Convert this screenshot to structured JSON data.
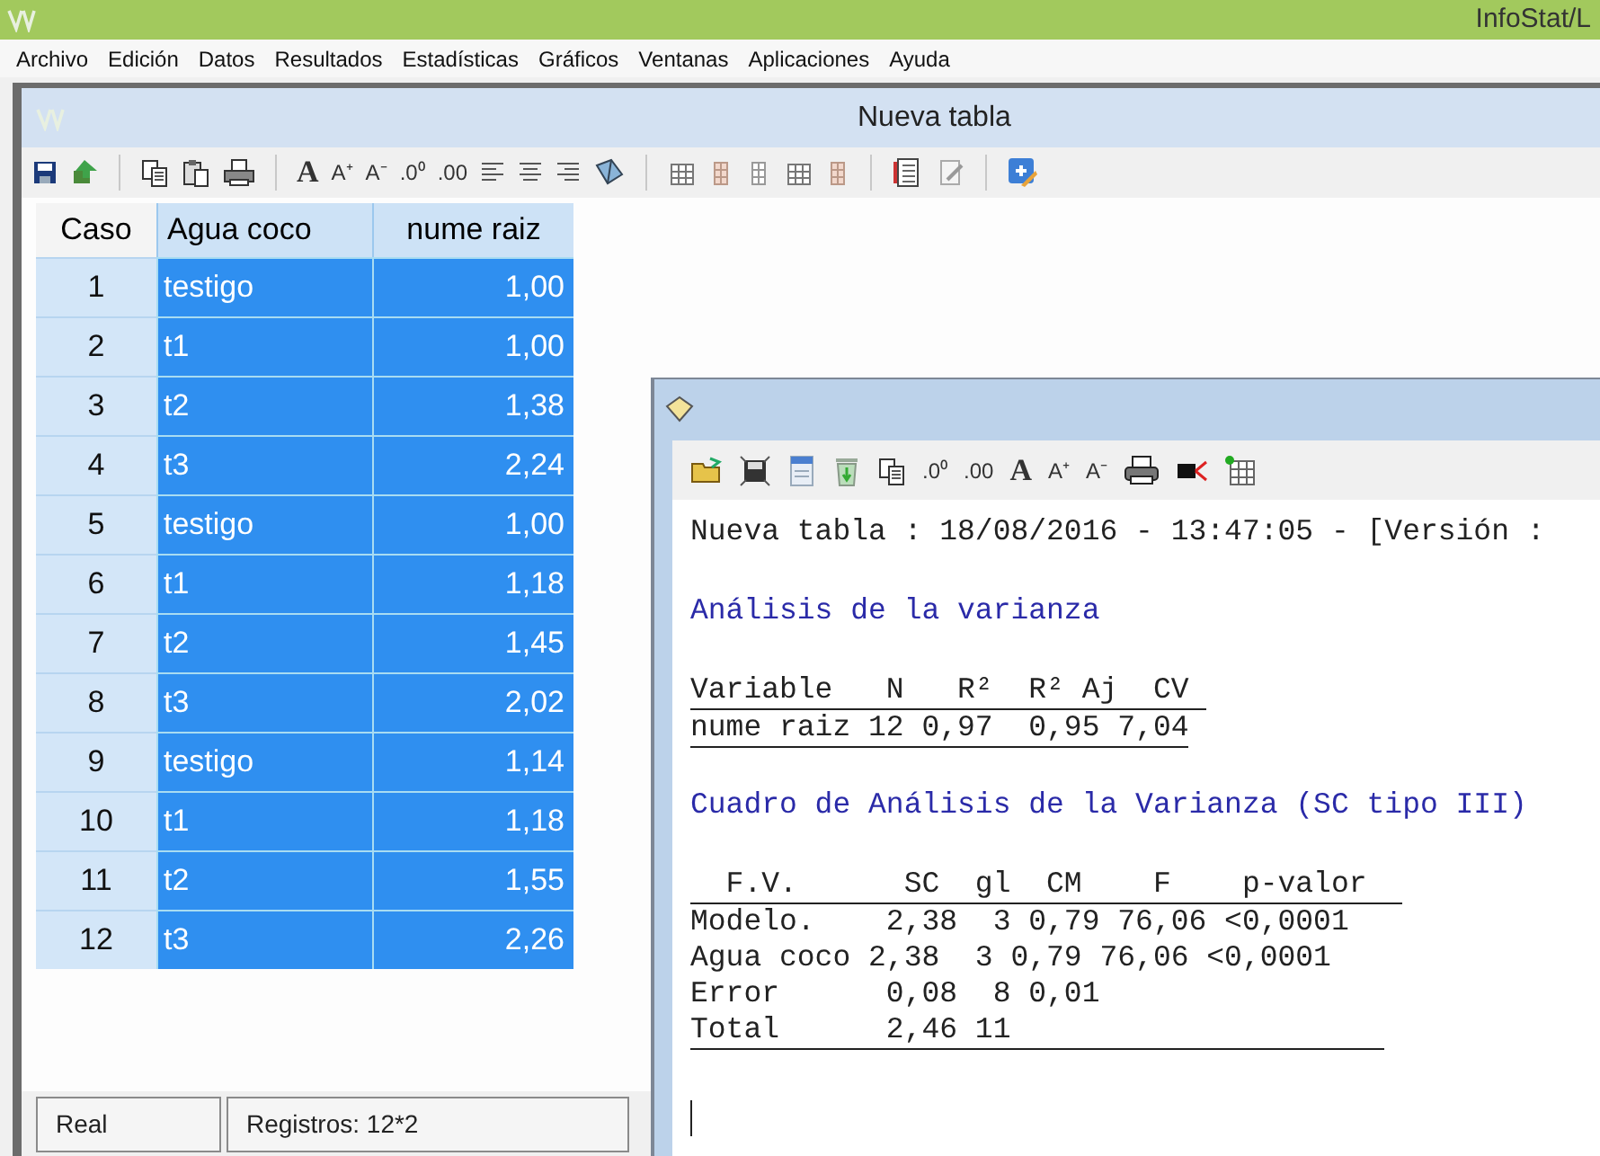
{
  "app": {
    "title": "InfoStat/L"
  },
  "menu": [
    "Archivo",
    "Edición",
    "Datos",
    "Resultados",
    "Estadísticas",
    "Gráficos",
    "Ventanas",
    "Aplicaciones",
    "Ayuda"
  ],
  "table_window": {
    "title": "Nueva tabla",
    "format_buttons": [
      {
        "kind": "font",
        "label": "A"
      },
      {
        "kind": "small",
        "label": "A⁺"
      },
      {
        "kind": "small",
        "label": "A⁻"
      },
      {
        "kind": "small",
        "label": ".0⁰"
      },
      {
        "kind": "small",
        "label": ".00"
      }
    ]
  },
  "table": {
    "columns": [
      "Caso",
      "Agua coco",
      "nume raiz"
    ],
    "rows": [
      {
        "caso": "1",
        "agua": "testigo",
        "nume": "1,00",
        "selected": true
      },
      {
        "caso": "2",
        "agua": "t1",
        "nume": "1,00",
        "selected": true
      },
      {
        "caso": "3",
        "agua": "t2",
        "nume": "1,38",
        "selected": true
      },
      {
        "caso": "4",
        "agua": "t3",
        "nume": "2,24",
        "selected": true
      },
      {
        "caso": "5",
        "agua": "testigo",
        "nume": "1,00",
        "selected": true
      },
      {
        "caso": "6",
        "agua": "t1",
        "nume": "1,18",
        "selected": true
      },
      {
        "caso": "7",
        "agua": "t2",
        "nume": "1,45",
        "selected": true
      },
      {
        "caso": "8",
        "agua": "t3",
        "nume": "2,02",
        "selected": true
      },
      {
        "caso": "9",
        "agua": "testigo",
        "nume": "1,14",
        "selected": true
      },
      {
        "caso": "10",
        "agua": "t1",
        "nume": "1,18",
        "selected": true
      },
      {
        "caso": "11",
        "agua": "t2",
        "nume": "1,55",
        "selected": true
      },
      {
        "caso": "12",
        "agua": "t3",
        "nume": "2,26",
        "selected": true
      }
    ]
  },
  "status_bar": [
    "Real",
    "Registros: 12*2"
  ],
  "output_window": {
    "format_buttons": [
      {
        "kind": "small",
        "label": ".0⁰"
      },
      {
        "kind": "small",
        "label": ".00"
      },
      {
        "kind": "font",
        "label": "A"
      },
      {
        "kind": "small",
        "label": "A⁺"
      },
      {
        "kind": "small",
        "label": "A⁻"
      }
    ],
    "lines": [
      {
        "kind": "info",
        "text": "Nueva tabla : 18/08/2016 - 13:47:05 - [Versión :"
      },
      {
        "kind": "title",
        "text": "Análisis de la varianza"
      },
      {
        "kind": "header",
        "text": "Variable   N   R²  R² Aj  CV "
      },
      {
        "kind": "end_row",
        "text": "nume raiz 12 0,97  0,95 7,04"
      },
      {
        "kind": "title",
        "text": "Cuadro de Análisis de la Varianza (SC tipo III)"
      },
      {
        "kind": "header",
        "text": "  F.V.      SC  gl  CM    F    p-valor  "
      },
      {
        "kind": "row",
        "text": "Modelo.    2,38  3 0,79 76,06 <0,0001"
      },
      {
        "kind": "row",
        "text": "Agua coco 2,38  3 0,79 76,06 <0,0001"
      },
      {
        "kind": "row",
        "text": "Error      0,08  8 0,01"
      },
      {
        "kind": "end_row",
        "text": "Total      2,46 11                     "
      }
    ]
  }
}
